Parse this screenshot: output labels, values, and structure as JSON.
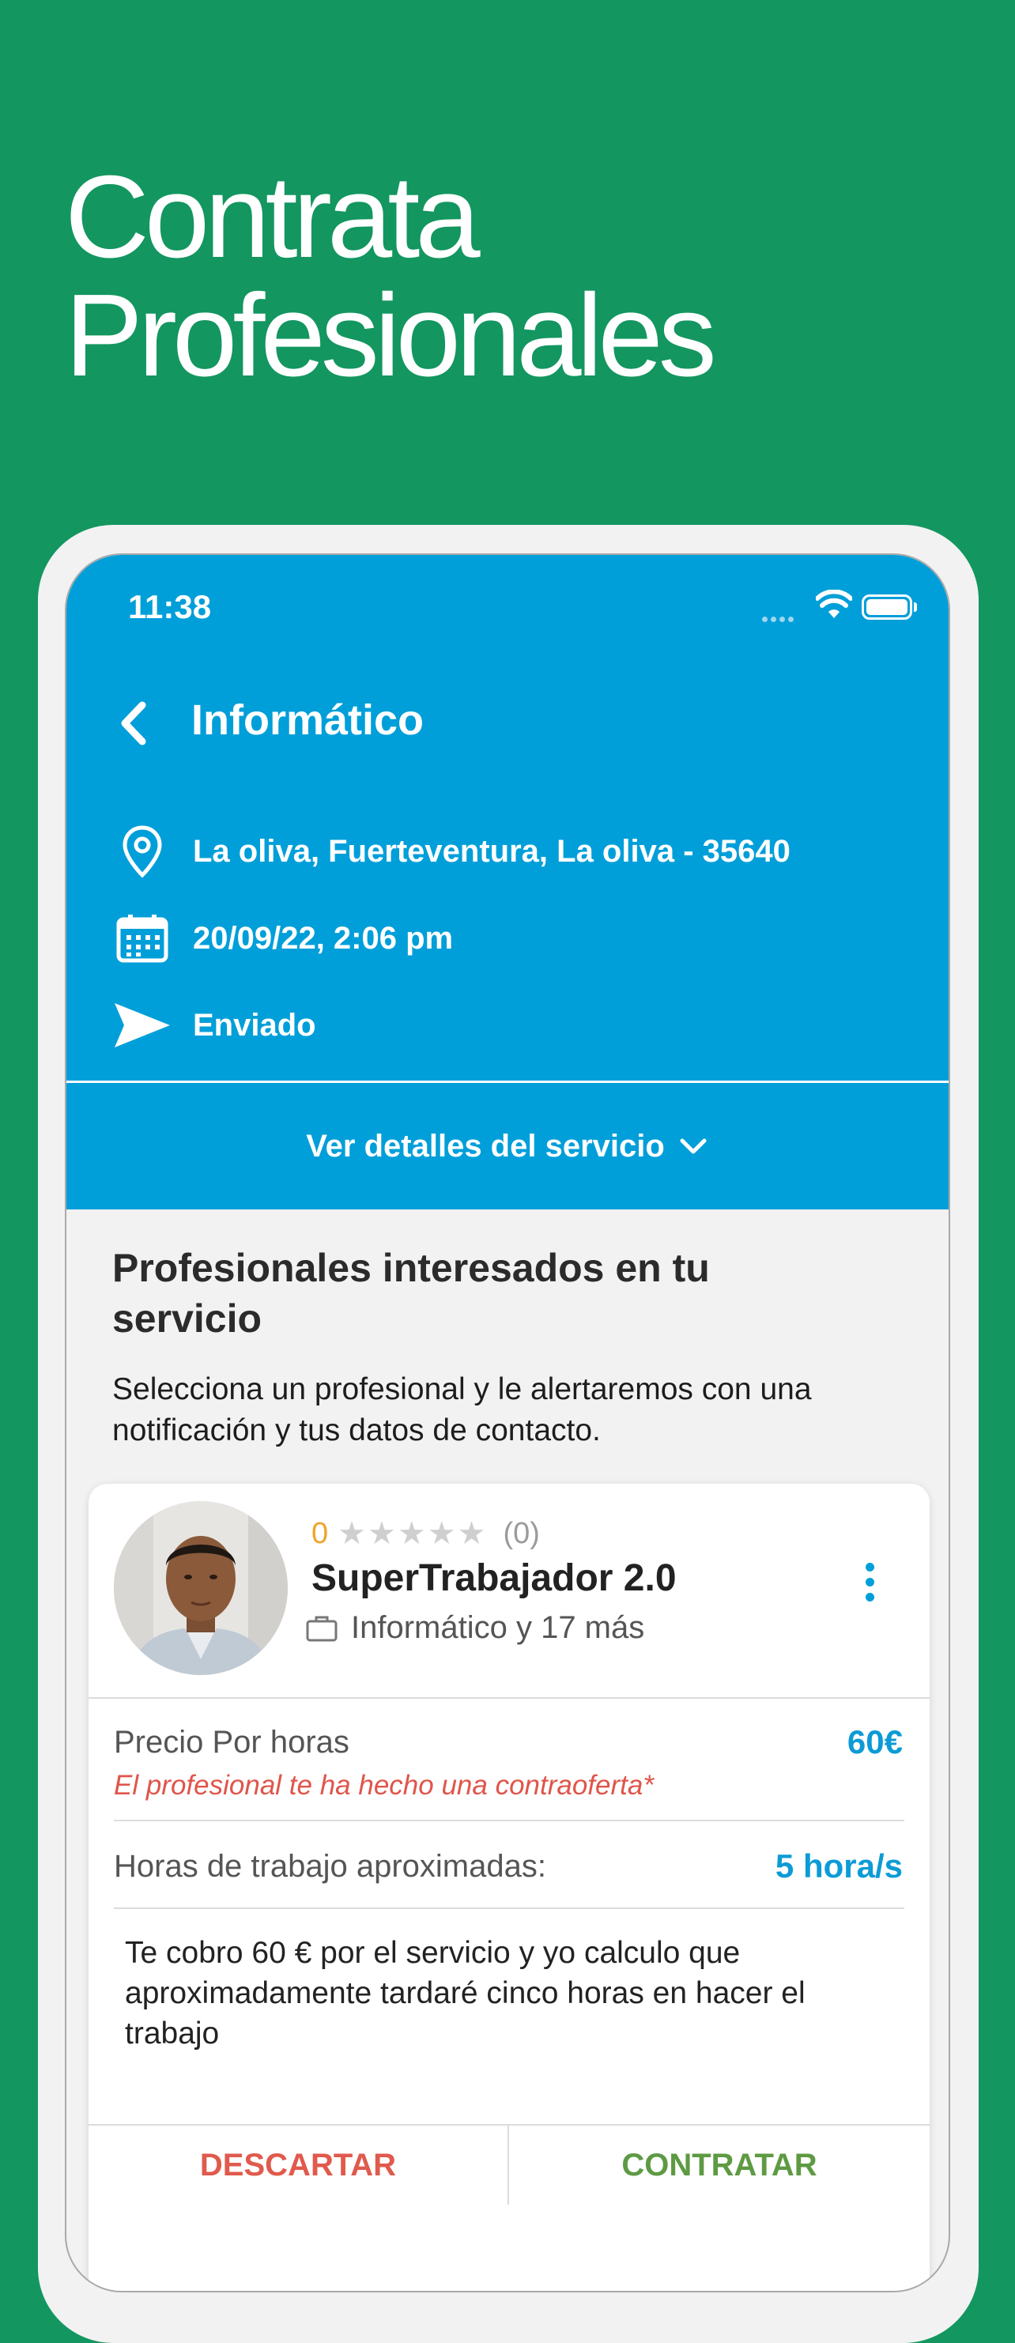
{
  "headline": {
    "line1": "Contrata",
    "line2": "Profesionales"
  },
  "status_bar": {
    "time": "11:38"
  },
  "nav": {
    "title": "Informático"
  },
  "request": {
    "location": "La oliva, Fuerteventura, La oliva - 35640",
    "datetime": "20/09/22, 2:06 pm",
    "status": "Enviado"
  },
  "details_button": "Ver detalles del servicio",
  "section": {
    "title": "Profesionales interesados en tu servicio",
    "subtitle": "Selecciona un profesional y le alertaremos con una notificación y tus datos de contacto."
  },
  "card": {
    "rating_value": "0",
    "stars": "★★★★★",
    "rating_count": "(0)",
    "name": "SuperTrabajador 2.0",
    "category": "Informático y 17 más",
    "price_label": "Precio Por horas",
    "price_value": "60€",
    "counteroffer": "El profesional te ha hecho una contraoferta*",
    "hours_label": "Horas de trabajo aproximadas:",
    "hours_value": "5 hora/s",
    "message": "Te cobro 60 € por el servicio y yo calculo que aproximadamente tardaré cinco horas en hacer el trabajo",
    "discard_label": "DESCARTAR",
    "hire_label": "CONTRATAR"
  },
  "colors": {
    "background": "#139660",
    "header_blue": "#009fd9",
    "accent_blue": "#0c9bd6",
    "discard_red": "#e05a4d",
    "hire_green": "#5e9a43",
    "rating_orange": "#f0a42a"
  },
  "icons": [
    "chevron-left-icon",
    "location-pin-icon",
    "calendar-icon",
    "send-icon",
    "chevron-down-icon",
    "briefcase-icon",
    "more-vertical-icon",
    "wifi-icon",
    "battery-icon"
  ]
}
